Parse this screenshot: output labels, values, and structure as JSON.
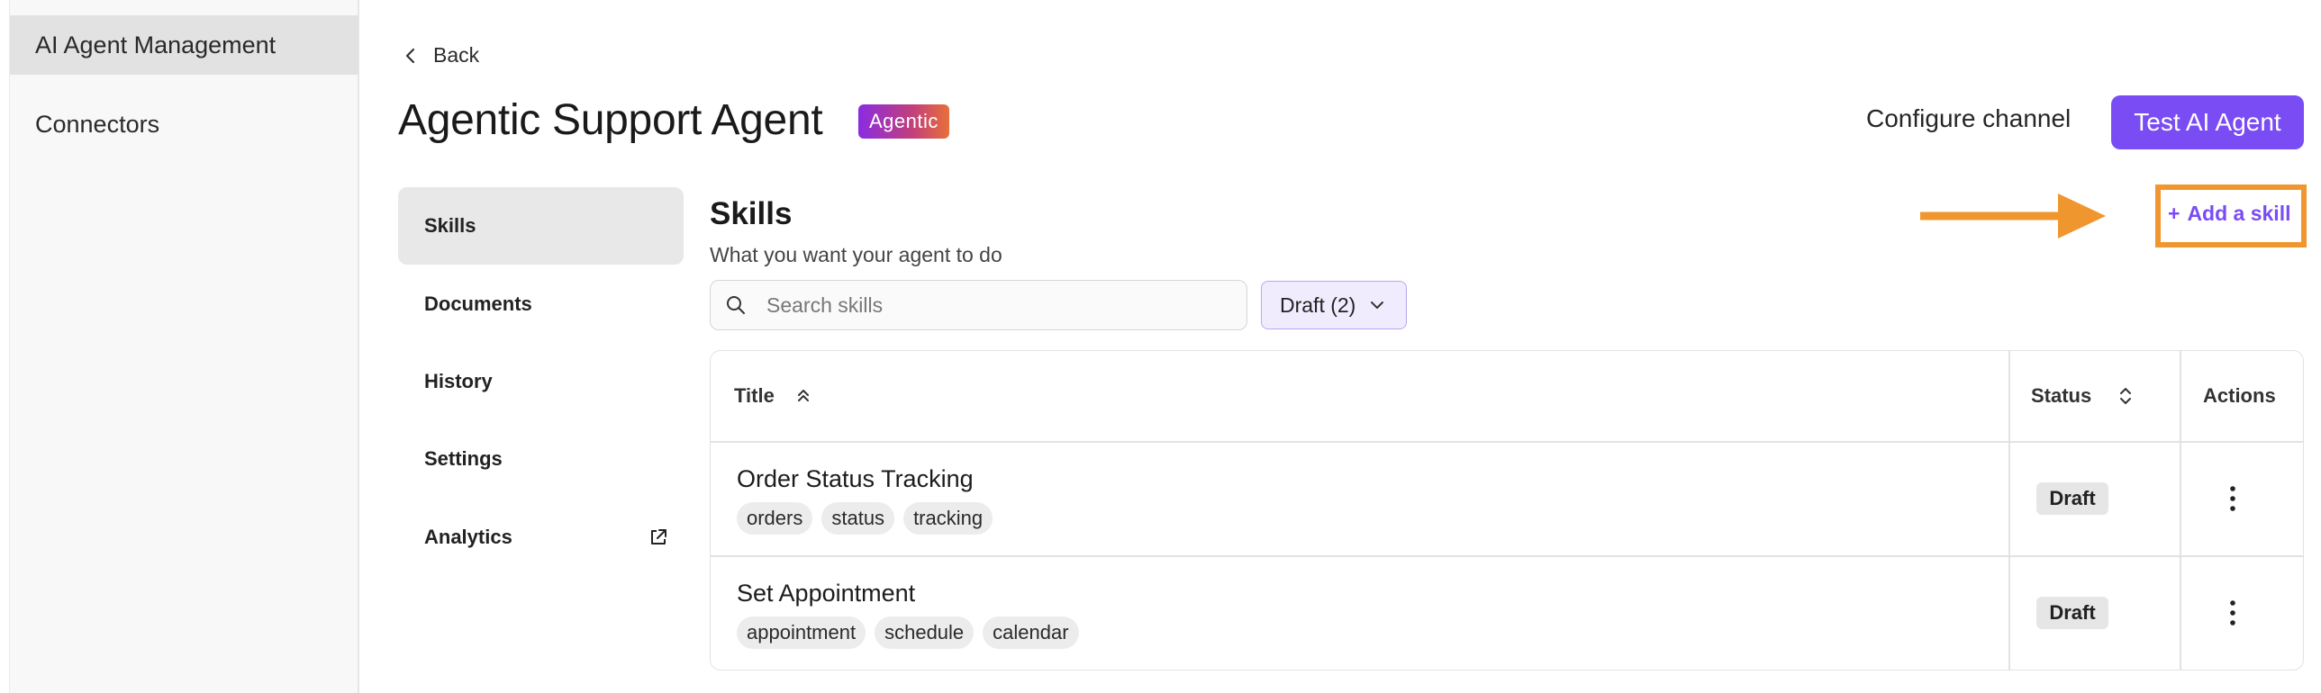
{
  "sidebar": {
    "items": [
      {
        "label": "AI Agent Management",
        "active": true
      },
      {
        "label": "Connectors",
        "active": false
      }
    ]
  },
  "header": {
    "back_label": "Back",
    "title": "Agentic Support Agent",
    "badge": "Agentic",
    "configure_label": "Configure channel",
    "test_label": "Test AI Agent"
  },
  "subnav": {
    "items": [
      {
        "label": "Skills",
        "active": true
      },
      {
        "label": "Documents"
      },
      {
        "label": "History"
      },
      {
        "label": "Settings"
      },
      {
        "label": "Analytics",
        "icon": "external-link-icon"
      }
    ]
  },
  "skills": {
    "title": "Skills",
    "subtitle": "What you want your agent to do",
    "add_label": "Add a skill",
    "search_placeholder": "Search skills",
    "filter_label": "Draft (2)",
    "columns": {
      "title": "Title",
      "status": "Status",
      "actions": "Actions"
    },
    "rows": [
      {
        "title": "Order Status Tracking",
        "tags": [
          "orders",
          "status",
          "tracking"
        ],
        "status": "Draft"
      },
      {
        "title": "Set Appointment",
        "tags": [
          "appointment",
          "schedule",
          "calendar"
        ],
        "status": "Draft"
      }
    ]
  },
  "colors": {
    "accent": "#7a4cf4",
    "highlight": "#f0962e",
    "badge_gradient": [
      "#8a2be2",
      "#e8703a"
    ]
  }
}
